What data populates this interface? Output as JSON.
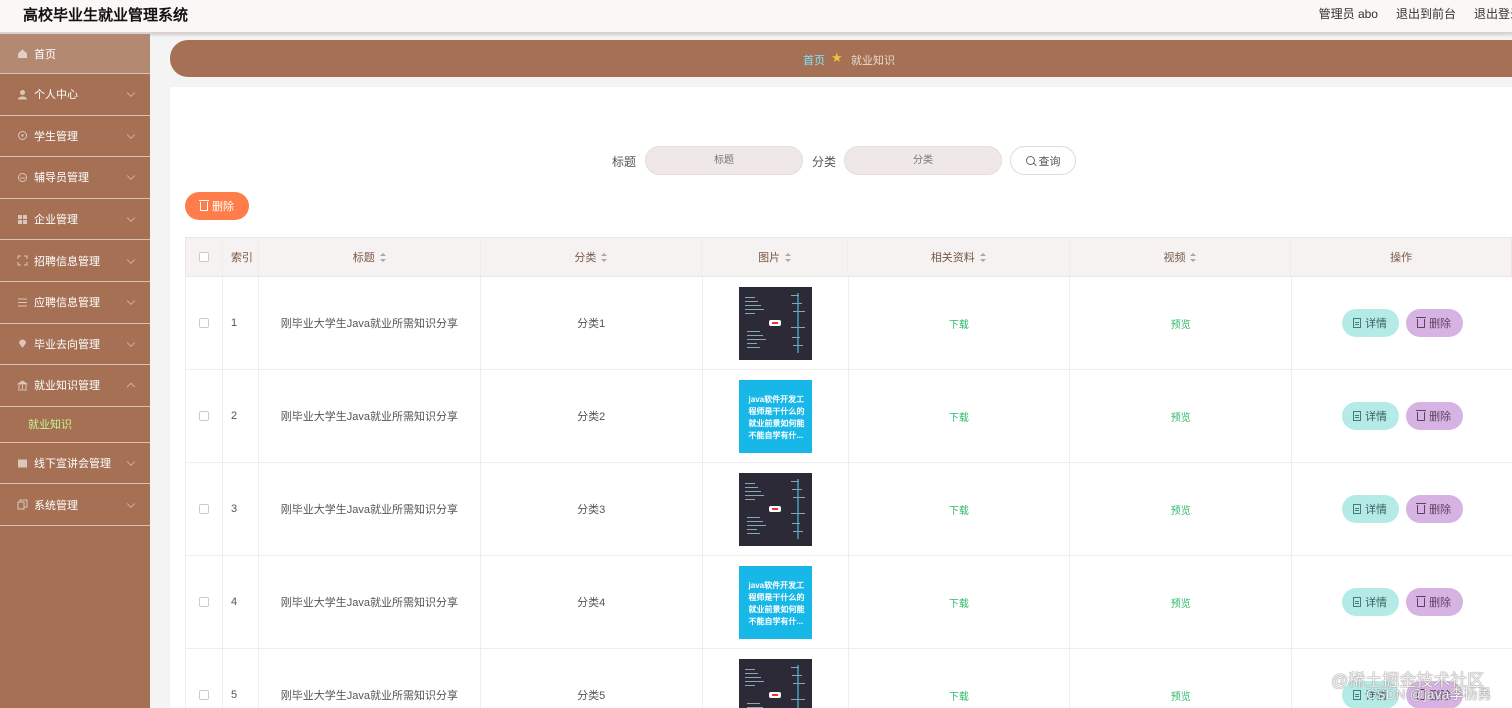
{
  "header": {
    "title": "高校毕业生就业管理系统",
    "user": "管理员 abo",
    "front_link": "退出到前台",
    "logout": "退出登录"
  },
  "sidebar": {
    "home": "首页",
    "items": [
      {
        "label": "个人中心",
        "icon": "person-icon"
      },
      {
        "label": "学生管理",
        "icon": "student-icon"
      },
      {
        "label": "辅导员管理",
        "icon": "counselor-icon"
      },
      {
        "label": "企业管理",
        "icon": "grid-icon"
      },
      {
        "label": "招聘信息管理",
        "icon": "frame-icon"
      },
      {
        "label": "应聘信息管理",
        "icon": "list-icon"
      },
      {
        "label": "毕业去向管理",
        "icon": "location-icon"
      },
      {
        "label": "就业知识管理",
        "icon": "bank-icon"
      }
    ],
    "active_sub": "就业知识",
    "items_after": [
      {
        "label": "线下宣讲会管理",
        "icon": "board-icon"
      },
      {
        "label": "系统管理",
        "icon": "copy-icon"
      }
    ]
  },
  "breadcrumb": {
    "home": "首页",
    "current": "就业知识"
  },
  "search": {
    "title_label": "标题",
    "title_placeholder": "标题",
    "category_label": "分类",
    "category_placeholder": "分类",
    "query_button": "查询"
  },
  "toolbar": {
    "delete_label": "删除"
  },
  "table": {
    "headers": {
      "index": "索引",
      "title": "标题",
      "category": "分类",
      "image": "图片",
      "resource": "相关资料",
      "video": "视频",
      "actions": "操作"
    },
    "rows": [
      {
        "index": "1",
        "title": "刚毕业大学生Java就业所需知识分享",
        "category": "分类1",
        "image": "dark",
        "resource": "下载",
        "video": "预览"
      },
      {
        "index": "2",
        "title": "刚毕业大学生Java就业所需知识分享",
        "category": "分类2",
        "image": "blue",
        "resource": "下载",
        "video": "预览"
      },
      {
        "index": "3",
        "title": "刚毕业大学生Java就业所需知识分享",
        "category": "分类3",
        "image": "dark",
        "resource": "下载",
        "video": "预览"
      },
      {
        "index": "4",
        "title": "刚毕业大学生Java就业所需知识分享",
        "category": "分类4",
        "image": "blue",
        "resource": "下载",
        "video": "预览"
      },
      {
        "index": "5",
        "title": "刚毕业大学生Java就业所需知识分享",
        "category": "分类5",
        "image": "dark",
        "resource": "下载",
        "video": "预览"
      }
    ],
    "detail_label": "详情",
    "delete_label": "删除",
    "blue_thumb_text": "java软件开发工程师是干什么的就业前景如何能不能自学有什..."
  },
  "watermark": {
    "line1": "@稀土掘金技术社区",
    "line2": "CSDN @java李杨勇"
  },
  "colors": {
    "brand": "#a57053",
    "accent_orange": "#ff7d4a",
    "detail_btn": "#b4ebe7",
    "delete_btn": "#d7b3e3",
    "link_green": "#2eb86a"
  }
}
